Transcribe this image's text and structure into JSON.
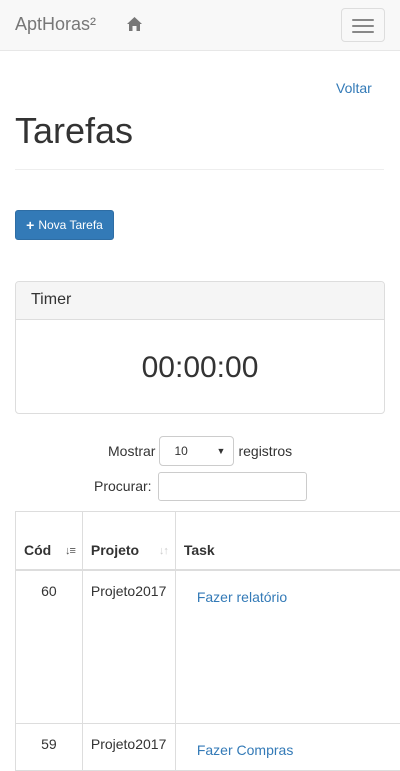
{
  "navbar": {
    "brand": "AptHoras²",
    "home_icon": "home-icon",
    "menu_icon": "hamburger-icon"
  },
  "page": {
    "back_label": "Voltar",
    "title": "Tarefas",
    "new_task_label": "Nova Tarefa"
  },
  "timer": {
    "heading": "Timer",
    "value": "00:00:00"
  },
  "datatable": {
    "length_prefix": "Mostrar",
    "length_value": "10",
    "length_suffix": "registros",
    "search_label": "Procurar:",
    "search_value": "",
    "columns": [
      "Cód",
      "Projeto",
      "Task"
    ],
    "rows": [
      {
        "cod": "60",
        "projeto": "Projeto2017",
        "task": "Fazer relatório"
      },
      {
        "cod": "59",
        "projeto": "Projeto2017",
        "task": "Fazer Compras"
      }
    ]
  },
  "colors": {
    "link": "#337ab7",
    "primary": "#337ab7",
    "navbar_bg": "#f8f8f8"
  }
}
